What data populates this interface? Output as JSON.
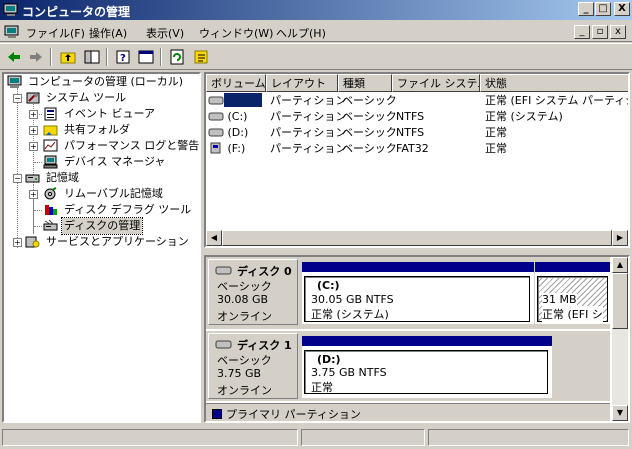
{
  "window": {
    "title": "コンピュータの管理"
  },
  "title_buttons": {
    "minimize": "_",
    "maximize": "□",
    "close": "X"
  },
  "menu": [
    "ファイル(F)",
    "操作(A)",
    "表示(V)",
    "ウィンドウ(W)",
    "ヘルプ(H)"
  ],
  "mdi_buttons": {
    "minimize": "_",
    "restore": "▫",
    "close": "x"
  },
  "tree": {
    "root": "コンピュータの管理 (ローカル)",
    "system_tools": "システム ツール",
    "event_viewer": "イベント ビューア",
    "shared_folders": "共有フォルダ",
    "perf_logs": "パフォーマンス ログと警告",
    "device_manager": "デバイス マネージャ",
    "storage": "記憶域",
    "removable": "リムーバブル記憶域",
    "defrag": "ディスク デフラグ ツール",
    "disk_mgmt": "ディスクの管理",
    "services": "サービスとアプリケーション"
  },
  "list": {
    "headers": [
      "ボリューム",
      "レイアウト",
      "種類",
      "ファイル システム",
      "状態"
    ],
    "rows": [
      {
        "volume": "",
        "layout": "パーティション",
        "type": "ベーシック",
        "fs": "",
        "status": "正常 (EFI システム パーティション)"
      },
      {
        "volume": "(C:)",
        "layout": "パーティション",
        "type": "ベーシック",
        "fs": "NTFS",
        "status": "正常 (システム)"
      },
      {
        "volume": "(D:)",
        "layout": "パーティション",
        "type": "ベーシック",
        "fs": "NTFS",
        "status": "正常"
      },
      {
        "volume": "(F:)",
        "layout": "パーティション",
        "type": "ベーシック",
        "fs": "FAT32",
        "status": "正常"
      }
    ]
  },
  "disks": [
    {
      "name": "ディスク 0",
      "kind": "ベーシック",
      "size": "30.08 GB",
      "state": "オンライン",
      "partitions": [
        {
          "label": "(C:)",
          "detail": "30.05 GB NTFS",
          "status": "正常 (システム)"
        },
        {
          "label": "",
          "detail": "31 MB",
          "status": "正常 (EFI シ"
        }
      ]
    },
    {
      "name": "ディスク 1",
      "kind": "ベーシック",
      "size": "3.75 GB",
      "state": "オンライン",
      "partitions": [
        {
          "label": "(D:)",
          "detail": "3.75 GB NTFS",
          "status": "正常"
        }
      ]
    }
  ],
  "legend": {
    "primary": "プライマリ パーティション",
    "primary_color": "#00008b"
  },
  "colors": {
    "title_start": "#0a246a",
    "title_end": "#a6caf0",
    "partition_bar": "#00008b",
    "selection": "#0a246a"
  }
}
